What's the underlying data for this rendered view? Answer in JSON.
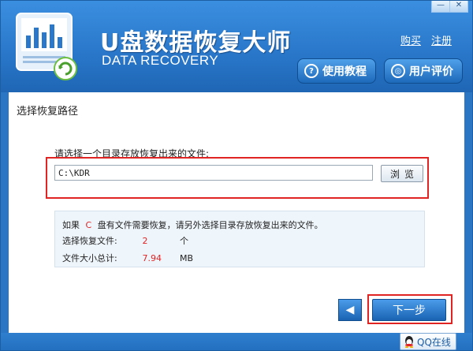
{
  "window": {
    "title_main": "U盘数据恢复大师",
    "title_sub": "DATA RECOVERY",
    "minimize_glyph": "—",
    "close_glyph": "✕"
  },
  "header": {
    "buy_link": "购买",
    "register_link": "注册",
    "tutorial_button": "使用教程",
    "review_button": "用户评价",
    "tutorial_icon": "question-icon",
    "review_icon": "chat-icon"
  },
  "content": {
    "section_title": "选择恢复路径",
    "prompt": "请选择一个目录存放恢复出来的文件:",
    "path_value": "C:\\KDR",
    "browse_label": "浏览",
    "info": {
      "line1_prefix": "如果",
      "drive_letter": "C",
      "line1_suffix": "盘有文件需要恢复，请另外选择目录存放恢复出来的文件。",
      "files_label": "选择恢复文件:",
      "files_count": "2",
      "files_unit": "个",
      "size_label": "文件大小总计:",
      "size_value": "7.94",
      "size_unit": "MB"
    },
    "back_glyph": "◀",
    "next_label": "下一步"
  },
  "footer": {
    "qq_label": "QQ在线"
  },
  "colors": {
    "header_blue": "#2a78cb",
    "highlight_red": "#e02424",
    "info_bg": "#eef5fb"
  }
}
